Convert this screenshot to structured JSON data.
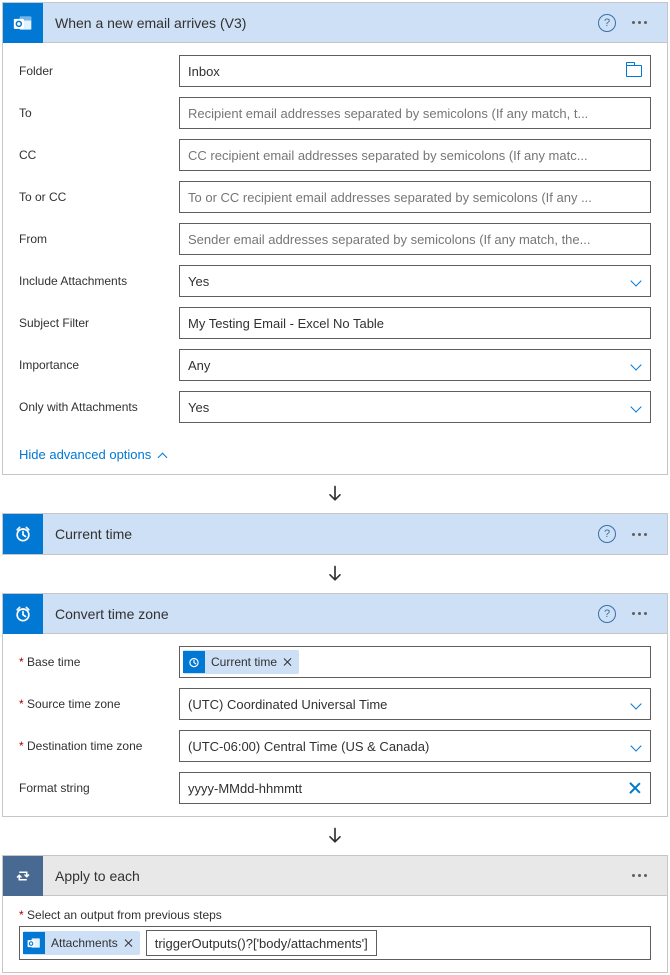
{
  "step1": {
    "title": "When a new email arrives (V3)",
    "fields": {
      "folder": {
        "label": "Folder",
        "value": "Inbox"
      },
      "to": {
        "label": "To",
        "placeholder": "Recipient email addresses separated by semicolons (If any match, t..."
      },
      "cc": {
        "label": "CC",
        "placeholder": "CC recipient email addresses separated by semicolons (If any matc..."
      },
      "to_or_cc": {
        "label": "To or CC",
        "placeholder": "To or CC recipient email addresses separated by semicolons (If any ..."
      },
      "from": {
        "label": "From",
        "placeholder": "Sender email addresses separated by semicolons (If any match, the..."
      },
      "include_attachments": {
        "label": "Include Attachments",
        "value": "Yes"
      },
      "subject_filter": {
        "label": "Subject Filter",
        "value": "My Testing Email - Excel No Table"
      },
      "importance": {
        "label": "Importance",
        "value": "Any"
      },
      "only_with_attachments": {
        "label": "Only with Attachments",
        "value": "Yes"
      }
    },
    "advanced_toggle": "Hide advanced options"
  },
  "step2": {
    "title": "Current time"
  },
  "step3": {
    "title": "Convert time zone",
    "fields": {
      "base_time": {
        "label": "Base time",
        "token": "Current time"
      },
      "source_tz": {
        "label": "Source time zone",
        "value": "(UTC) Coordinated Universal Time"
      },
      "dest_tz": {
        "label": "Destination time zone",
        "value": "(UTC-06:00) Central Time (US & Canada)"
      },
      "format": {
        "label": "Format string",
        "value": "yyyy-MMdd-hhmmtt"
      }
    }
  },
  "step4": {
    "title": "Apply to each",
    "select_label": "Select an output from previous steps",
    "token": "Attachments",
    "expression": "triggerOutputs()?['body/attachments']"
  }
}
